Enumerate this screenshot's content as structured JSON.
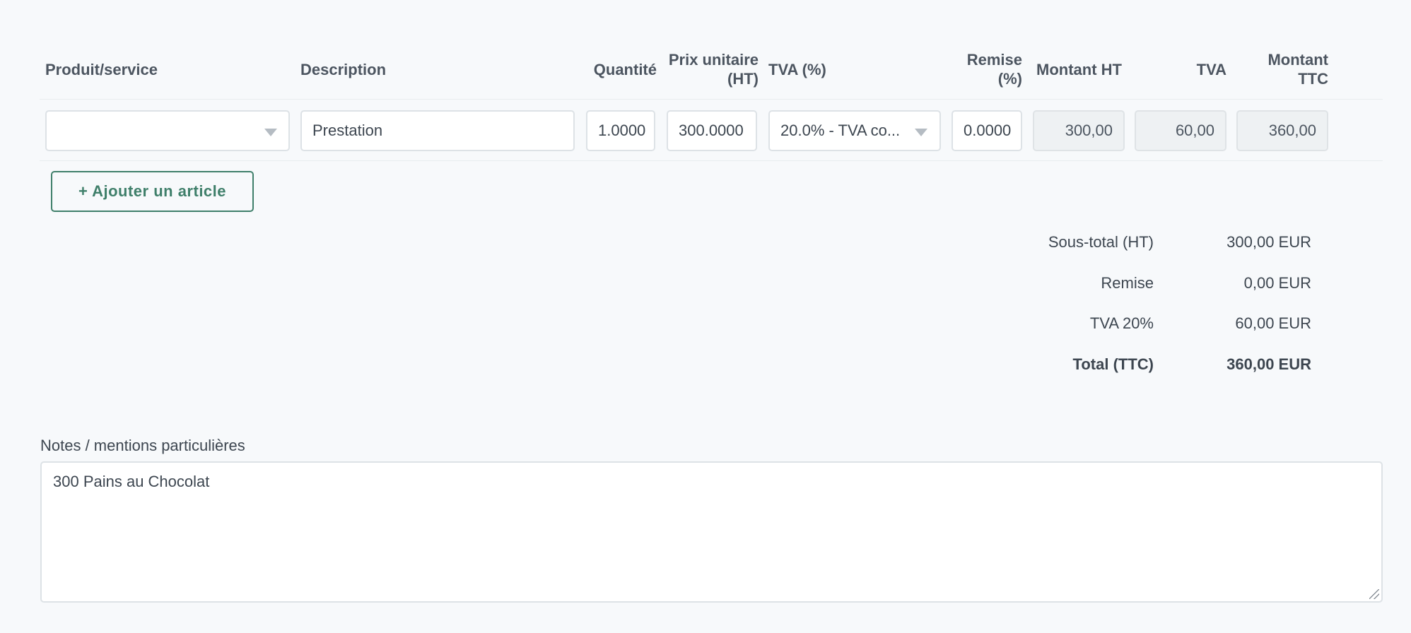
{
  "columns": {
    "product": "Produit/service",
    "description": "Description",
    "quantity": "Quantité",
    "unit_price_line1": "Prix unitaire",
    "unit_price_line2": "(HT)",
    "vat_rate": "TVA (%)",
    "discount_line1": "Remise",
    "discount_line2": "(%)",
    "amount_ht": "Montant HT",
    "vat": "TVA",
    "amount_ttc_line1": "Montant",
    "amount_ttc_line2": "TTC"
  },
  "row": {
    "product": "",
    "description": "Prestation",
    "quantity": "1.0000",
    "unit_price": "300.0000",
    "vat_rate": "20.0% - TVA co...",
    "discount": "0.0000",
    "amount_ht": "300,00",
    "vat": "60,00",
    "amount_ttc": "360,00"
  },
  "add_item_label": "+ Ajouter un article",
  "totals": [
    {
      "label": "Sous-total (HT)",
      "value": "300,00 EUR"
    },
    {
      "label": "Remise",
      "value": "0,00 EUR"
    },
    {
      "label": "TVA 20%",
      "value": "60,00 EUR"
    },
    {
      "label": "Total (TTC)",
      "value": "360,00 EUR"
    }
  ],
  "notes": {
    "label": "Notes / mentions particulières",
    "value": "300 Pains au Chocolat"
  },
  "colors": {
    "accent": "#3f7f6a",
    "background": "#f7f9fb",
    "readonly_field": "#eef1f3"
  },
  "icons": {
    "select_caret": "chevron-down-icon",
    "resize_handle": "resize-handle-icon"
  }
}
